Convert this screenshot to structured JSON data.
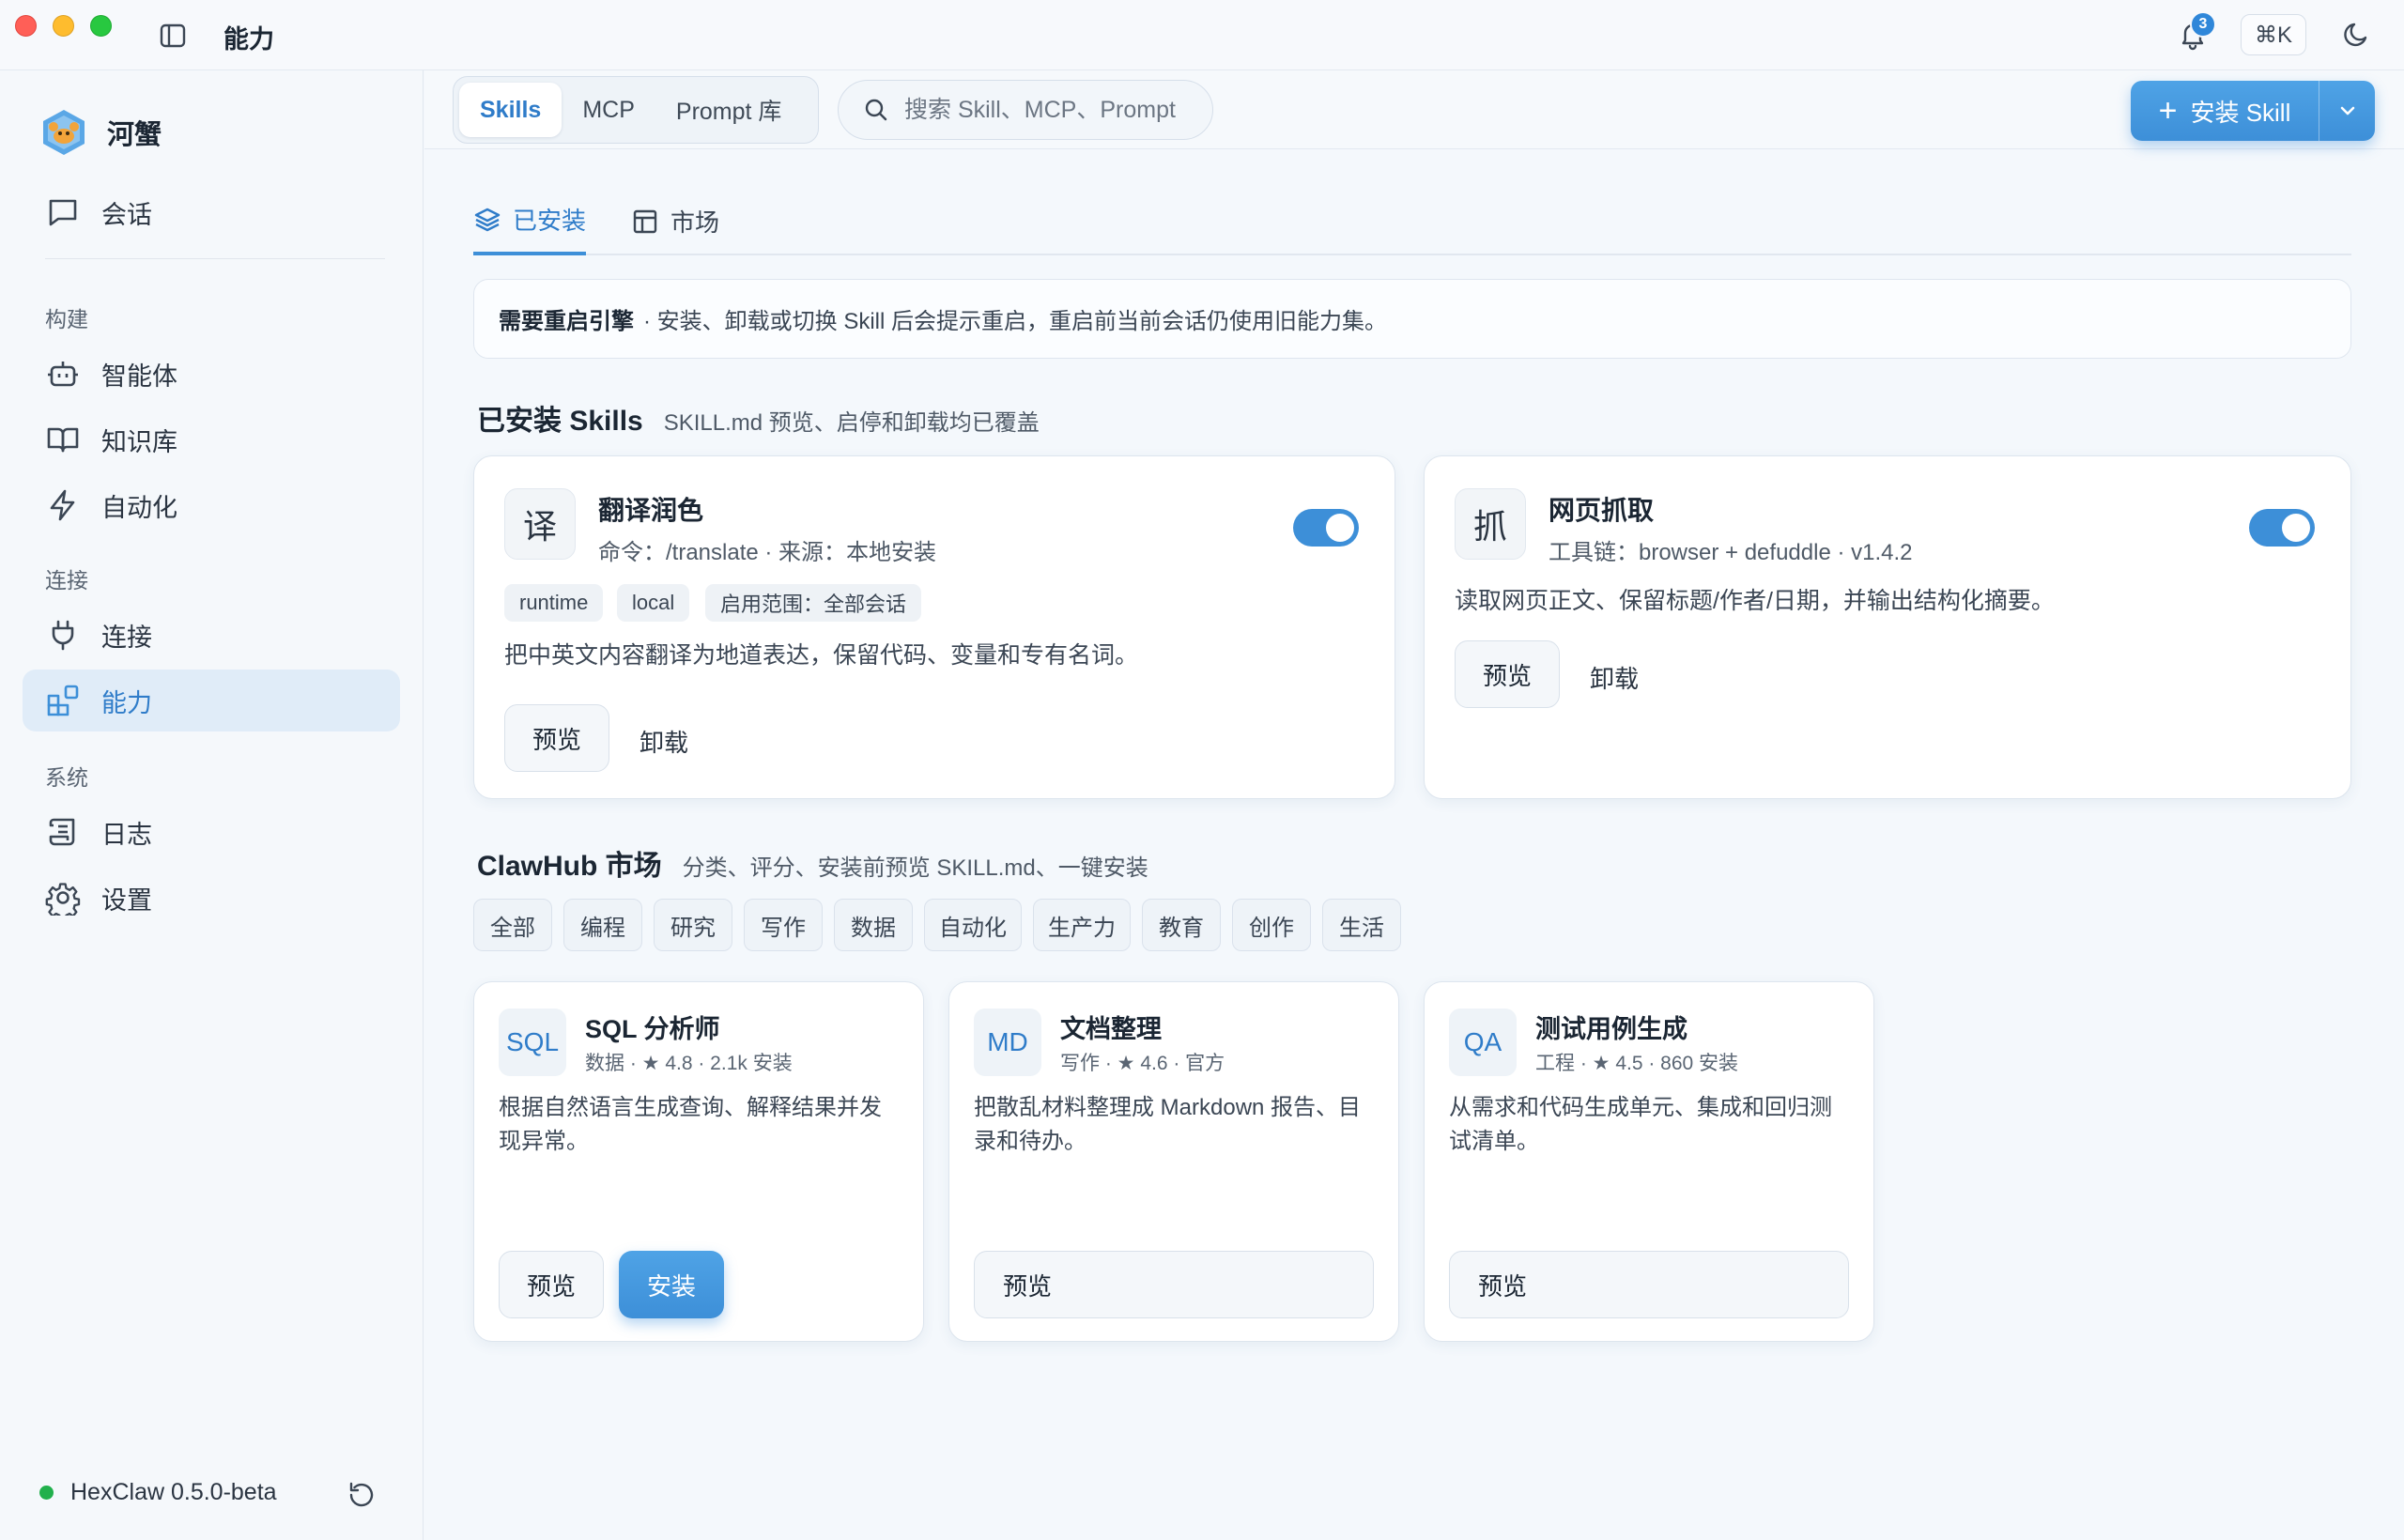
{
  "window": {
    "title": "能力",
    "notification_count": "3",
    "shortcut": "⌘K"
  },
  "sidebar": {
    "brand": "河蟹",
    "chat": "会话",
    "sections": {
      "build": "构建",
      "connect": "连接",
      "system": "系统"
    },
    "items": {
      "agents": "智能体",
      "knowledge": "知识库",
      "automation": "自动化",
      "connections": "连接",
      "capabilities": "能力",
      "logs": "日志",
      "settings": "设置"
    },
    "active": "capabilities",
    "version": "HexClaw 0.5.0-beta"
  },
  "topbar": {
    "segments": [
      "Skills",
      "MCP",
      "Prompt 库"
    ],
    "active_segment": "Skills",
    "search_placeholder": "搜索 Skill、MCP、Prompt",
    "install_label": "安装 Skill"
  },
  "tabs": {
    "installed": "已安装",
    "market": "市场",
    "active": "installed"
  },
  "notice": {
    "strong": "需要重启引擎",
    "text": "· 安装、卸载或切换 Skill 后会提示重启，重启前当前会话仍使用旧能力集。"
  },
  "installed": {
    "title": "已安装 Skills",
    "subtitle": "SKILL.md 预览、启停和卸载均已覆盖",
    "skills": [
      {
        "icon": "译",
        "name": "翻译润色",
        "meta": "命令：/translate · 来源：本地安装",
        "enabled": true,
        "tags": [
          "runtime",
          "local",
          "启用范围：全部会话"
        ],
        "description": "把中英文内容翻译为地道表达，保留代码、变量和专有名词。",
        "preview": "预览",
        "uninstall": "卸载"
      },
      {
        "icon": "抓",
        "name": "网页抓取",
        "meta": "工具链：browser + defuddle · v1.4.2",
        "enabled": true,
        "tags": [],
        "description": "读取网页正文、保留标题/作者/日期，并输出结构化摘要。",
        "preview": "预览",
        "uninstall": "卸载"
      }
    ]
  },
  "market": {
    "title": "ClawHub 市场",
    "subtitle": "分类、评分、安装前预览 SKILL.md、一键安装",
    "categories": [
      "全部",
      "编程",
      "研究",
      "写作",
      "数据",
      "自动化",
      "生产力",
      "教育",
      "创作",
      "生活"
    ],
    "items": [
      {
        "icon": "SQL",
        "name": "SQL 分析师",
        "meta": "数据 · ★ 4.8 · 2.1k 安装",
        "description": "根据自然语言生成查询、解释结果并发现异常。",
        "preview": "预览",
        "install": "安装"
      },
      {
        "icon": "MD",
        "name": "文档整理",
        "meta": "写作 · ★ 4.6 · 官方",
        "description": "把散乱材料整理成 Markdown 报告、目录和待办。",
        "preview": "预览"
      },
      {
        "icon": "QA",
        "name": "测试用例生成",
        "meta": "工程 · ★ 4.5 · 860 安装",
        "description": "从需求和代码生成单元、集成和回归测试清单。",
        "preview": "预览"
      }
    ]
  },
  "colors": {
    "accent": "#3d8fd8",
    "status_online": "#21b04c"
  }
}
